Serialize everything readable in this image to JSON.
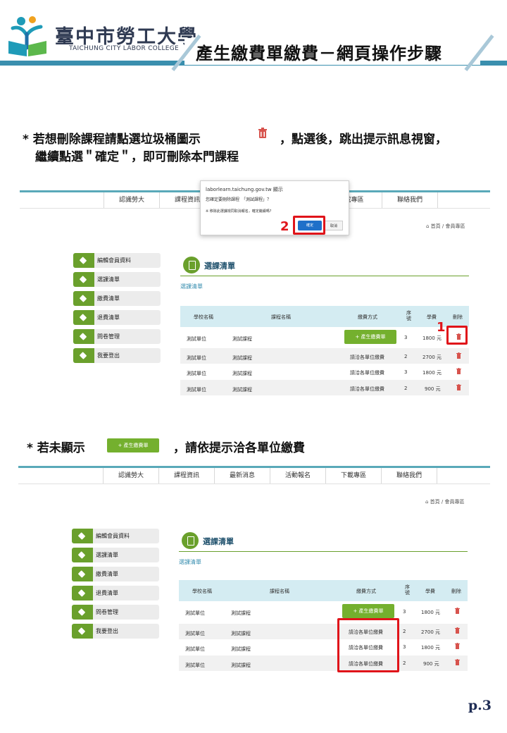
{
  "header": {
    "college_zh": "臺中市勞工大學",
    "college_en": "TAICHUNG CITY LABOR COLLEGE",
    "page_title": "產生繳費單繳費－網頁操作步驟",
    "brand_color": "#3a8fae"
  },
  "instruction1": {
    "line1_a": "* 若想刪除課程請點選垃圾桶圖示",
    "line1_b": "，點選後，跳出提示訊息視窗，",
    "line2": "繼續點選＂確定＂，即可刪除本門課程"
  },
  "instruction2": {
    "part_a": "* 若未顯示",
    "button_label": "+ 產生繳費單",
    "part_b": "，請依提示洽各單位繳費"
  },
  "nav": {
    "items": [
      "認識勞大",
      "課程資訊",
      "最新消息",
      "活動報名",
      "下載專區",
      "聯絡我們"
    ],
    "partial_item": "載專區",
    "breadcrumb": "首頁 / 會員專區"
  },
  "sidebar": {
    "items": [
      "編輯會員資料",
      "選課清單",
      "繳費清單",
      "退費清單",
      "問卷管理",
      "我要登出"
    ]
  },
  "section": {
    "title": "選課清單",
    "subtitle": "選課清單"
  },
  "table": {
    "headers": [
      "學校名稱",
      "課程名稱",
      "繳費方式",
      "序號",
      "學費",
      "刪除"
    ],
    "rows": [
      {
        "school": "測試單位",
        "course": "測試課程",
        "pay": "+ 產生繳費單",
        "serial": "3",
        "fee": "1800 元"
      },
      {
        "school": "測試單位",
        "course": "測試課程",
        "pay": "請洽各單位繳費",
        "serial": "2",
        "fee": "2700 元"
      },
      {
        "school": "測試單位",
        "course": "測試課程",
        "pay": "請洽各單位繳費",
        "serial": "3",
        "fee": "1800 元"
      },
      {
        "school": "測試單位",
        "course": "測試課程",
        "pay": "請洽各單位繳費",
        "serial": "2",
        "fee": "900 元"
      }
    ]
  },
  "dialog": {
    "site": "laborlearn.taichung.gov.tw 顯示",
    "line1": "您確定要刪除課程　「測試課程」？",
    "line2": "※ 移除此選課視同取消報名，確定繼續嗎?",
    "ok": "確定",
    "cancel": "取消"
  },
  "markers": {
    "step1": "1",
    "step2": "2"
  },
  "page_number": "p.3"
}
